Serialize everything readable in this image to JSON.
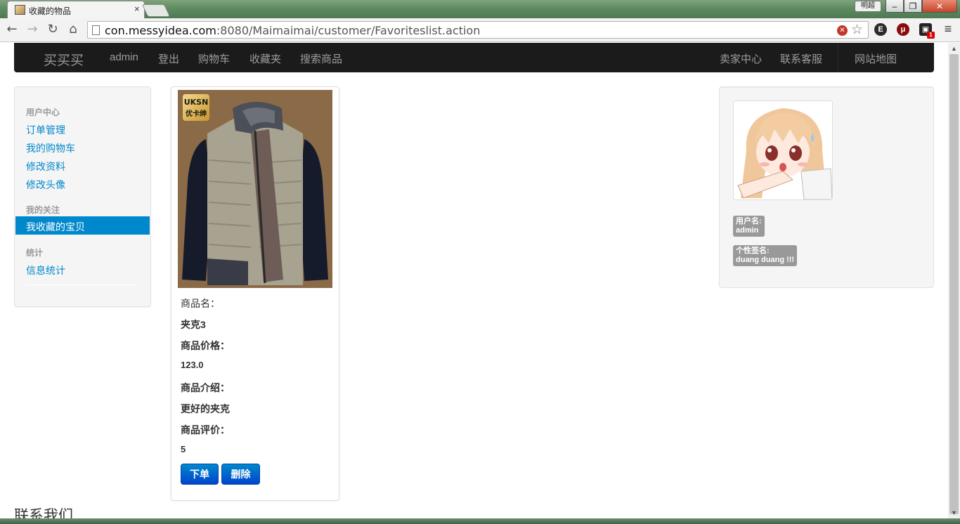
{
  "browser": {
    "tab_title": "收藏的物品",
    "tab_close": "×",
    "user_chip": "明超",
    "window_controls": {
      "minimize": "–",
      "maximize": "❐",
      "close": "✕"
    },
    "nav": {
      "back": "←",
      "forward": "→",
      "reload": "↻",
      "home": "⌂"
    },
    "url_host": "con.messyidea.com",
    "url_rest": ":8080/Maimaimai/customer/Favoriteslist.action",
    "star": "☆",
    "extensions": {
      "evernote": "E",
      "ublock": "μ",
      "screen": "▣",
      "screen_badge": "1",
      "menu": "≡"
    }
  },
  "navbar": {
    "brand": "买买买",
    "left_links": [
      "admin",
      "登出",
      "购物车",
      "收藏夹",
      "搜索商品"
    ],
    "right_links": [
      "卖家中心",
      "联系客服",
      "网站地图"
    ]
  },
  "sidebar": {
    "sections": [
      {
        "header": "用户中心",
        "items": [
          "订单管理",
          "我的购物车",
          "修改资料",
          "修改头像"
        ]
      },
      {
        "header": "我的关注",
        "items": [
          "我收藏的宝贝"
        ]
      },
      {
        "header": "统计",
        "items": [
          "信息统计"
        ]
      }
    ],
    "active": "我收藏的宝贝"
  },
  "product": {
    "logo_text_1": "UKSN",
    "logo_text_2": "优卡绅",
    "name_label": "商品名：",
    "name": "夹克3",
    "price_label": "商品价格：",
    "price": "123.0",
    "desc_label": "商品介绍：",
    "desc": "更好的夹克",
    "rating_label": "商品评价：",
    "rating": "5",
    "order_button": "下单",
    "delete_button": "删除"
  },
  "profile": {
    "username_label": "用户名:",
    "username": "admin",
    "signature_label": "个性签名:",
    "signature": "duang duang !!!"
  },
  "footer": {
    "title": "联系我们"
  },
  "colors": {
    "navbar_bg": "#1b1b1b",
    "link_blue": "#0088cc",
    "active_bg": "#0088cc",
    "button_blue": "#0044cc",
    "label_gray": "#999999"
  }
}
